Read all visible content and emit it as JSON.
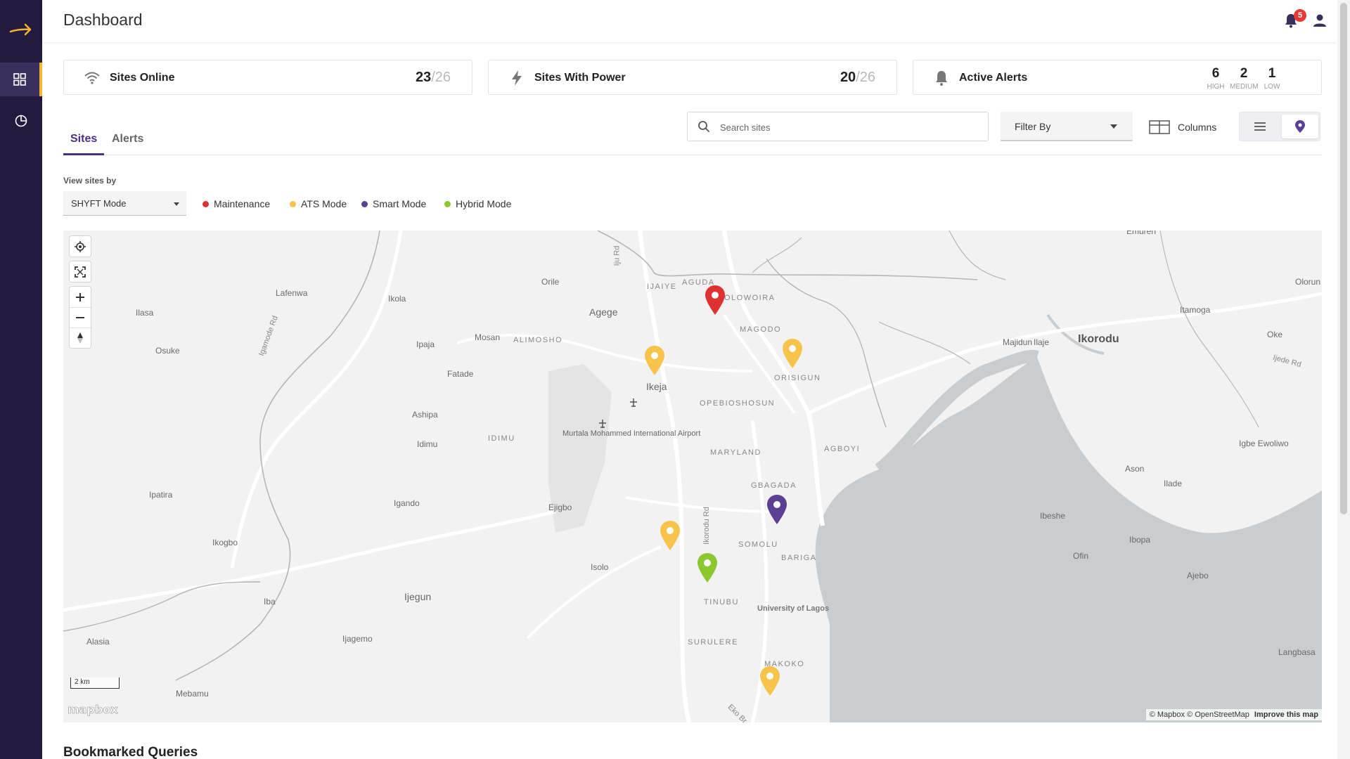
{
  "header": {
    "title": "Dashboard",
    "notifications_count": "5"
  },
  "sidebar": {
    "items": [
      {
        "name": "dashboard",
        "icon": "grid-icon",
        "active": true
      },
      {
        "name": "analytics",
        "icon": "pie-chart-icon",
        "active": false
      }
    ]
  },
  "stats": {
    "sites_online": {
      "label": "Sites Online",
      "value": "23",
      "total": "/26"
    },
    "sites_power": {
      "label": "Sites With Power",
      "value": "20",
      "total": "/26"
    },
    "active_alerts": {
      "label": "Active Alerts",
      "high": "6",
      "high_label": "HIGH",
      "medium": "2",
      "medium_label": "MEDIUM",
      "low": "1",
      "low_label": "LOW"
    }
  },
  "tabs": [
    {
      "label": "Sites"
    },
    {
      "label": "Alerts"
    }
  ],
  "toolbar": {
    "search_placeholder": "Search sites",
    "filter_label": "Filter By",
    "columns_label": "Columns"
  },
  "view_by": {
    "label": "View sites by",
    "selected": "SHYFT Mode",
    "legend": [
      {
        "label": "Maintenance",
        "color": "#e03131"
      },
      {
        "label": "ATS Mode",
        "color": "#f7c34a"
      },
      {
        "label": "Smart Mode",
        "color": "#5b3f94"
      },
      {
        "label": "Hybrid Mode",
        "color": "#8bc72e"
      }
    ]
  },
  "map": {
    "places": {
      "emuren": "Emuren",
      "orile": "Orile",
      "ijaiye": "IJAIYE",
      "agudu": "AGUDA",
      "olowoira": "OLOWOIRA",
      "olorun": "Olorun",
      "lafenwa": "Lafenwa",
      "ikola": "Ikola",
      "agege": "Agege",
      "ilasa": "Ilasa",
      "osuke": "Osuke",
      "mosan": "Mosan",
      "alimosho": "ALIMOSHO",
      "ipaja": "Ipaja",
      "magodo": "MAGODO",
      "itamoga": "Itamoga",
      "oke": "Oke",
      "majidun": "Majidun",
      "ilaje": "Ilaje",
      "ikorodu": "Ikorodu",
      "fatade": "Fatade",
      "orisigun": "ORISIGUN",
      "ikeja": "Ikeja",
      "opebi": "OPEBI",
      "oshosun": "OSHOSUN",
      "ashipa": "Ashipa",
      "idimu": "Idimu",
      "idimu_caps": "IDIMU",
      "maryland": "MARYLAND",
      "agboyi": "AGBOYI",
      "igbe": "Igbe Ewoliwo",
      "ason": "Ason",
      "ipatira": "Ipatira",
      "igando": "Igando",
      "ejigbo": "Ejigbo",
      "gbagada": "GBAGADA",
      "ilade": "Ilade",
      "ibeshe": "Ibeshe",
      "ikogbo": "Ikogbo",
      "somolu": "SOMOLU",
      "ibopa": "Ibopa",
      "ofin": "Ofin",
      "isolo": "Isolo",
      "bariga": "BARIGA",
      "ajebo": "Ajebo",
      "iba": "Iba",
      "ijegun": "Ijegun",
      "tinubu": "TINUBU",
      "unilag": "University of Lagos",
      "alasia": "Alasia",
      "ijagemo": "Ijagemo",
      "surulere": "SURULERE",
      "langbasa": "Langbasa",
      "makoko": "MAKOKO",
      "mebamu": "Mebamu",
      "airport": "Murtala Mohammed International Airport",
      "ijurd": "Iju Rd",
      "igamode": "Igamode Rd",
      "ikorodurd": "Ikorodu Rd",
      "ijederd": "Ijede Rd",
      "ekord": "Eko Br"
    },
    "pins": [
      {
        "mode": "Maintenance",
        "color": "#e03131"
      },
      {
        "mode": "ATS Mode",
        "color": "#f7c34a"
      },
      {
        "mode": "ATS Mode",
        "color": "#f7c34a"
      },
      {
        "mode": "Smart Mode",
        "color": "#5b3f94"
      },
      {
        "mode": "ATS Mode",
        "color": "#f7c34a"
      },
      {
        "mode": "Hybrid Mode",
        "color": "#8bc72e"
      },
      {
        "mode": "ATS Mode",
        "color": "#f7c34a"
      }
    ],
    "scale_label": "2 km",
    "logo_text": "mapbox",
    "attribution": "© Mapbox © OpenStreetMap",
    "improve_link": "Improve this map"
  },
  "bookmarked": {
    "title": "Bookmarked Queries"
  }
}
